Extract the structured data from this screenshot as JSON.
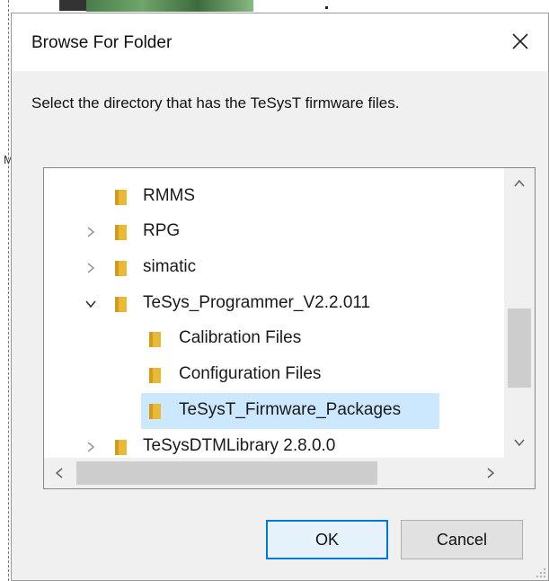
{
  "dialog": {
    "title": "Browse For Folder",
    "instruction": "Select the directory that has the TeSysT firmware files.",
    "ok_label": "OK",
    "cancel_label": "Cancel"
  },
  "background": {
    "side_letter": "M"
  },
  "tree": {
    "items": [
      {
        "label": "RMMS",
        "expander": "none"
      },
      {
        "label": "RPG",
        "expander": "collapsed"
      },
      {
        "label": "simatic",
        "expander": "collapsed"
      },
      {
        "label": "TeSys_Programmer_V2.2.011",
        "expander": "expanded"
      },
      {
        "label": "Calibration Files",
        "expander": "none"
      },
      {
        "label": "Configuration Files",
        "expander": "none"
      },
      {
        "label": "TeSysT_Firmware_Packages",
        "expander": "none",
        "selected": true
      },
      {
        "label": "TeSysDTMLibrary 2.8.0.0",
        "expander": "collapsed"
      }
    ]
  },
  "colors": {
    "folder": "#e8b936",
    "selection": "#cce8ff",
    "ok_border": "#0078d7"
  }
}
